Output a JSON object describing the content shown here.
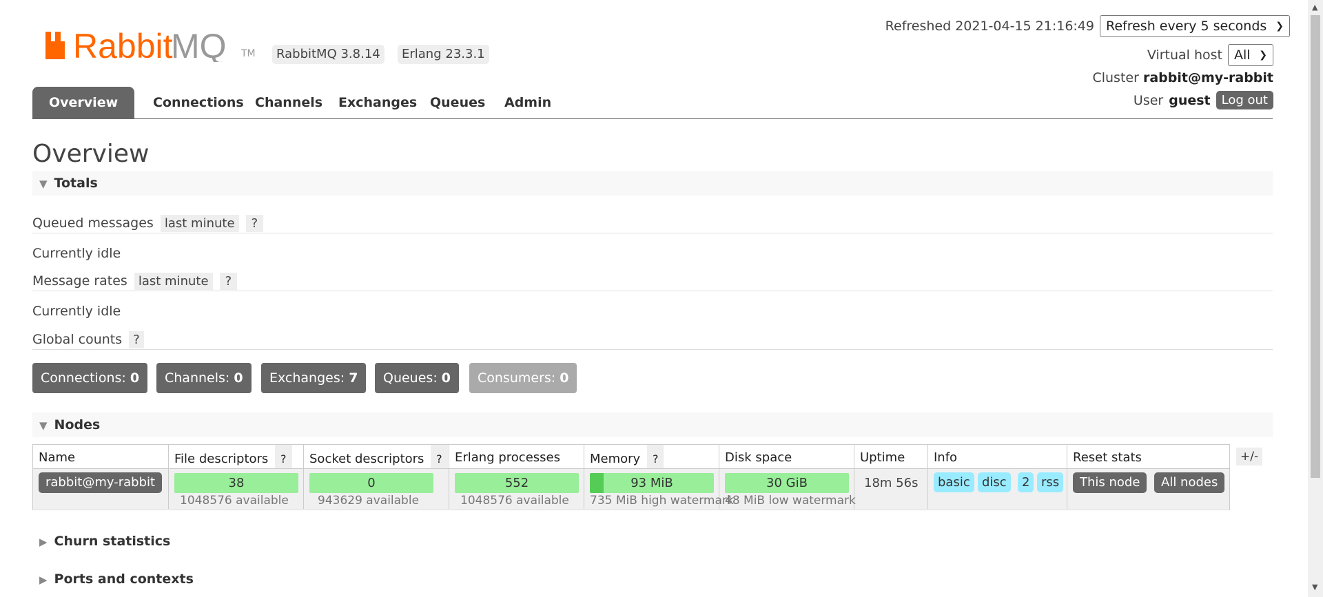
{
  "header": {
    "logo_text": "RabbitMQ",
    "tm": "TM",
    "rabbitmq_version": "RabbitMQ 3.8.14",
    "erlang_version": "Erlang 23.3.1",
    "refreshed_label": "Refreshed 2021-04-15 21:16:49",
    "refresh_select": "Refresh every 5 seconds",
    "vhost_label": "Virtual host",
    "vhost_select": "All",
    "cluster_label": "Cluster",
    "cluster_name": "rabbit@my-rabbit",
    "user_label": "User",
    "user_name": "guest",
    "logout": "Log out"
  },
  "tabs": [
    "Overview",
    "Connections",
    "Channels",
    "Exchanges",
    "Queues",
    "Admin"
  ],
  "page_title": "Overview",
  "totals": {
    "heading": "Totals",
    "queued_label": "Queued messages",
    "queued_range": "last minute",
    "help": "?",
    "idle1": "Currently idle",
    "rates_label": "Message rates",
    "rates_range": "last minute",
    "idle2": "Currently idle",
    "global_label": "Global counts"
  },
  "counters": [
    {
      "label": "Connections:",
      "value": "0"
    },
    {
      "label": "Channels:",
      "value": "0"
    },
    {
      "label": "Exchanges:",
      "value": "7"
    },
    {
      "label": "Queues:",
      "value": "0"
    },
    {
      "label": "Consumers:",
      "value": "0"
    }
  ],
  "nodes": {
    "heading": "Nodes",
    "columns": [
      "Name",
      "File descriptors",
      "Socket descriptors",
      "Erlang processes",
      "Memory",
      "Disk space",
      "Uptime",
      "Info",
      "Reset stats"
    ],
    "plus_minus": "+/-",
    "row": {
      "name": "rabbit@my-rabbit",
      "fd": "38",
      "fd_avail": "1048576 available",
      "sd": "0",
      "sd_avail": "943629 available",
      "ep": "552",
      "ep_avail": "1048576 available",
      "mem": "93 MiB",
      "mem_sub": "735 MiB high watermark",
      "disk": "30 GiB",
      "disk_sub": "48 MiB low watermark",
      "uptime": "18m 56s",
      "info": [
        "basic",
        "disc",
        "2",
        "rss"
      ],
      "reset_this": "This node",
      "reset_all": "All nodes"
    }
  },
  "collapsed_sections": [
    "Churn statistics",
    "Ports and contexts"
  ]
}
